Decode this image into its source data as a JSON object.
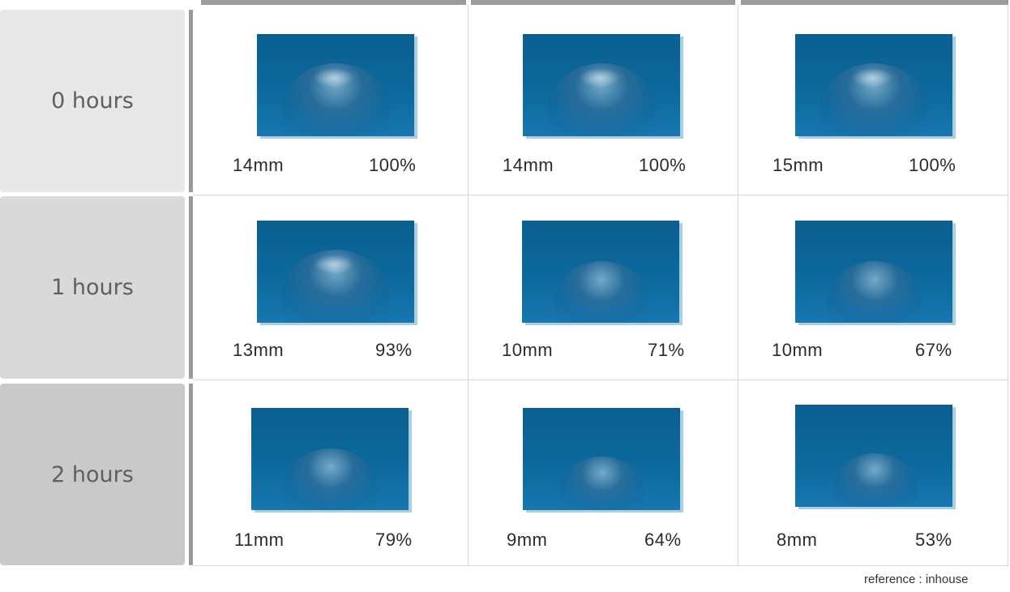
{
  "rows": [
    {
      "label": "0 hours",
      "cells": [
        {
          "size": "14mm",
          "percent": "100%"
        },
        {
          "size": "14mm",
          "percent": "100%"
        },
        {
          "size": "15mm",
          "percent": "100%"
        }
      ]
    },
    {
      "label": "1 hours",
      "cells": [
        {
          "size": "13mm",
          "percent": "93%"
        },
        {
          "size": "10mm",
          "percent": "71%"
        },
        {
          "size": "10mm",
          "percent": "67%"
        }
      ]
    },
    {
      "label": "2 hours",
      "cells": [
        {
          "size": "11mm",
          "percent": "79%"
        },
        {
          "size": "9mm",
          "percent": "64%"
        },
        {
          "size": "8mm",
          "percent": "53%"
        }
      ]
    }
  ],
  "footer": {
    "reference": "reference : inhouse"
  },
  "colors": {
    "row_label_bg": [
      "#e8e8e8",
      "#d9d9d9",
      "#c9c9c9"
    ],
    "accent_bar": "#9b9b9b",
    "photo_bg": "#0d6a9e"
  },
  "icons": [
    "water-droplet-photo"
  ]
}
